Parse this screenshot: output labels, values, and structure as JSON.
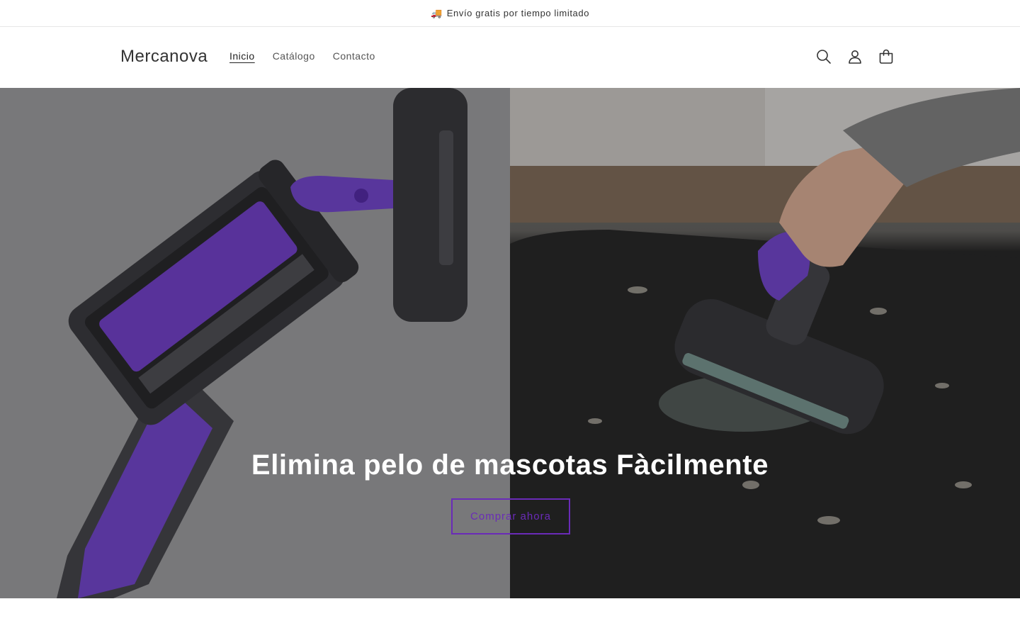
{
  "announcement": {
    "icon": "truck-icon",
    "text": "Envío gratis por tiempo limitado"
  },
  "header": {
    "logo": "Mercanova",
    "nav": [
      {
        "label": "Inicio",
        "active": true
      },
      {
        "label": "Catálogo",
        "active": false
      },
      {
        "label": "Contacto",
        "active": false
      }
    ],
    "icons": [
      "search-icon",
      "account-icon",
      "cart-icon"
    ]
  },
  "hero": {
    "title": "Elimina pelo de mascotas Fàcilmente",
    "button_label": "Comprar ahora",
    "accent_color": "#6a2bb8"
  }
}
